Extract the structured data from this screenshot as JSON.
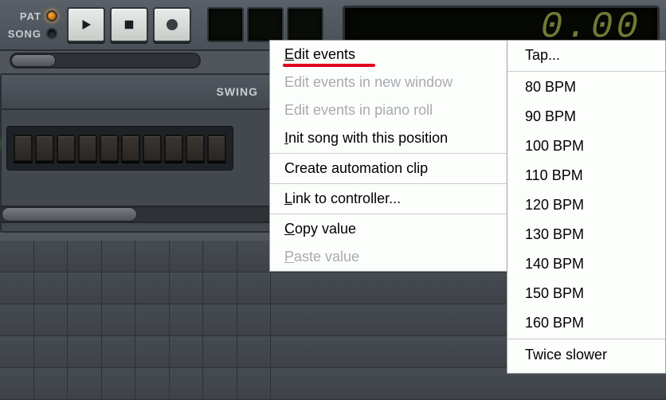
{
  "toolbar": {
    "mode": {
      "pat_label": "PAT",
      "song_label": "SONG"
    },
    "big_lcd_value": "0.00"
  },
  "panel": {
    "swing_label": "SWING"
  },
  "context_menu": {
    "edit_events": "dit events",
    "edit_events_prefix": "E",
    "edit_events_new_window": "Edit events in new window",
    "edit_events_piano_roll": "Edit events in piano roll",
    "init_song_prefix": "I",
    "init_song": "nit song with this position",
    "automation_clip": "Create automation clip",
    "link_controller_prefix": "L",
    "link_controller": "ink to controller...",
    "copy_prefix": "C",
    "copy_value": "opy value",
    "paste_prefix": "P",
    "paste_value": "aste value"
  },
  "submenu": {
    "tap": "Tap...",
    "bpm": [
      "80 BPM",
      "90 BPM",
      "100 BPM",
      "110 BPM",
      "120 BPM",
      "130 BPM",
      "140 BPM",
      "150 BPM",
      "160 BPM"
    ],
    "twice_slower_prefix": "T",
    "twice_slower": "wice slower"
  }
}
